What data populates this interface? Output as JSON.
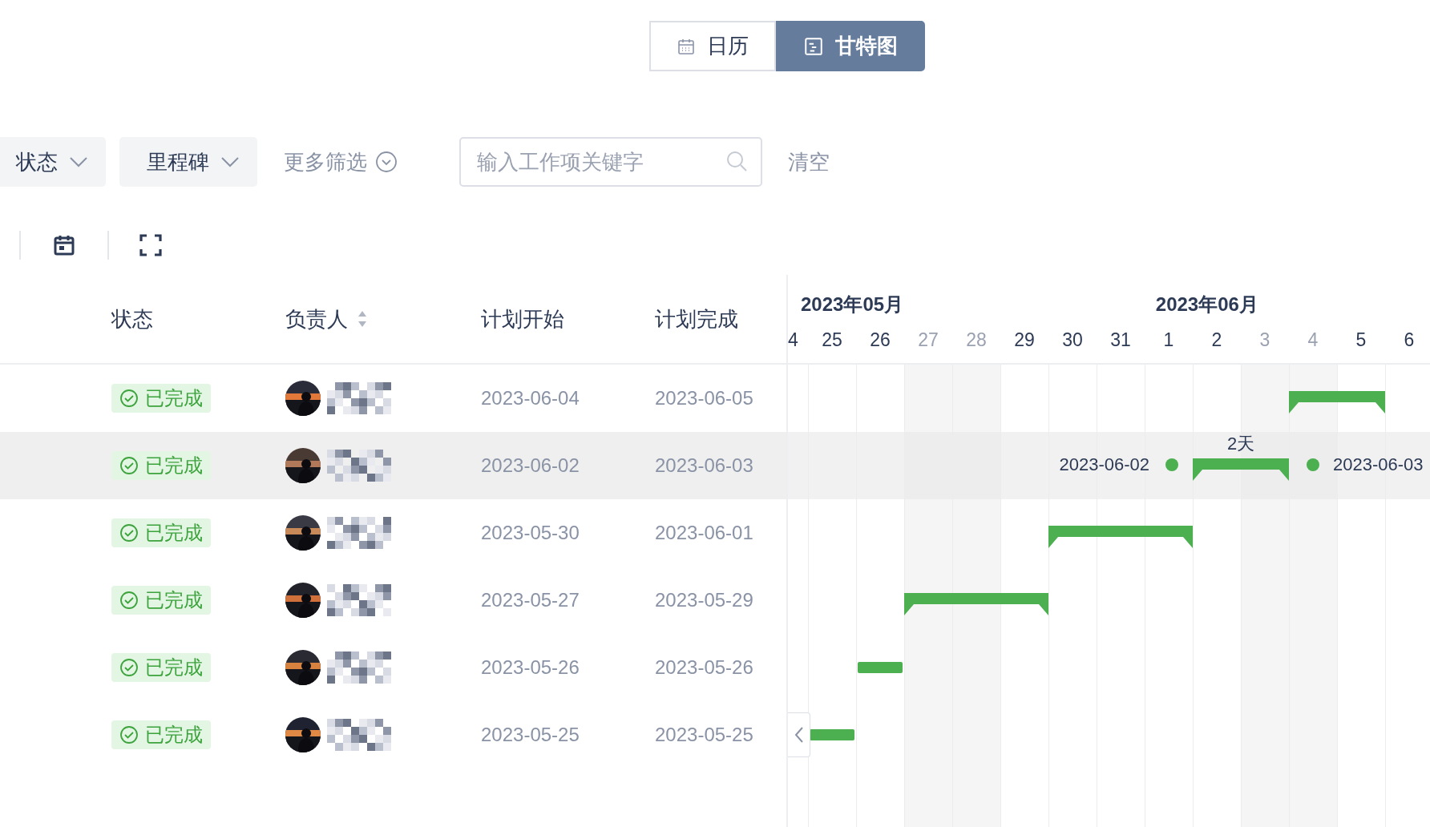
{
  "view_switch": [
    {
      "label": "日历",
      "selected": false
    },
    {
      "label": "甘特图",
      "selected": true
    }
  ],
  "filters": {
    "dropdowns": [
      {
        "label": "状态"
      },
      {
        "label": "里程碑"
      }
    ],
    "more": {
      "label": "更多筛选"
    },
    "search": {
      "placeholder": "输入工作项关键字"
    },
    "clear": {
      "label": "清空"
    }
  },
  "columns": [
    {
      "label": "状态",
      "sortable": false
    },
    {
      "label": "负责人",
      "sortable": true
    },
    {
      "label": "计划开始",
      "sortable": false
    },
    {
      "label": "计划完成",
      "sortable": false
    }
  ],
  "months": [
    {
      "label": "2023年05月",
      "days": [
        {
          "label": "4",
          "weekend": false
        },
        {
          "label": "25",
          "weekend": false
        },
        {
          "label": "26",
          "weekend": false
        },
        {
          "label": "27",
          "weekend": true
        },
        {
          "label": "28",
          "weekend": true
        },
        {
          "label": "29",
          "weekend": false
        },
        {
          "label": "30",
          "weekend": false
        },
        {
          "label": "31",
          "weekend": false
        }
      ]
    },
    {
      "label": "2023年06月",
      "days": [
        {
          "label": "1",
          "weekend": false
        },
        {
          "label": "2",
          "weekend": false
        },
        {
          "label": "3",
          "weekend": true
        },
        {
          "label": "4",
          "weekend": true
        },
        {
          "label": "5",
          "weekend": false
        },
        {
          "label": "6",
          "weekend": false
        }
      ]
    }
  ],
  "rows": [
    {
      "selected": false,
      "status": {
        "label": "已完成",
        "kind": "done"
      },
      "assignee": {
        "name": {
          "kind": "pixelated"
        }
      },
      "start": "2023-06-04",
      "end": "2023-06-05",
      "bar": {
        "kind": "summary"
      }
    },
    {
      "selected": true,
      "status": {
        "label": "已完成",
        "kind": "done"
      },
      "assignee": {
        "name": {
          "kind": "pixelated"
        }
      },
      "start": "2023-06-02",
      "end": "2023-06-03",
      "bar": {
        "kind": "summary",
        "start_label": "2023-06-02",
        "end_label": "2023-06-03",
        "duration": "2天"
      }
    },
    {
      "selected": false,
      "status": {
        "label": "已完成",
        "kind": "done"
      },
      "assignee": {
        "name": {
          "kind": "pixelated"
        }
      },
      "start": "2023-05-30",
      "end": "2023-06-01",
      "bar": {
        "kind": "summary"
      }
    },
    {
      "selected": false,
      "status": {
        "label": "已完成",
        "kind": "done"
      },
      "assignee": {
        "name": {
          "kind": "pixelated"
        }
      },
      "start": "2023-05-27",
      "end": "2023-05-29",
      "bar": {
        "kind": "summary"
      }
    },
    {
      "selected": false,
      "status": {
        "label": "已完成",
        "kind": "done"
      },
      "assignee": {
        "name": {
          "kind": "pixelated"
        }
      },
      "start": "2023-05-26",
      "end": "2023-05-26",
      "bar": {
        "kind": "task"
      }
    },
    {
      "selected": false,
      "status": {
        "label": "已完成",
        "kind": "done"
      },
      "assignee": {
        "name": {
          "kind": "pixelated"
        }
      },
      "start": "2023-05-25",
      "end": "2023-05-25",
      "bar": {
        "kind": "task"
      }
    }
  ]
}
